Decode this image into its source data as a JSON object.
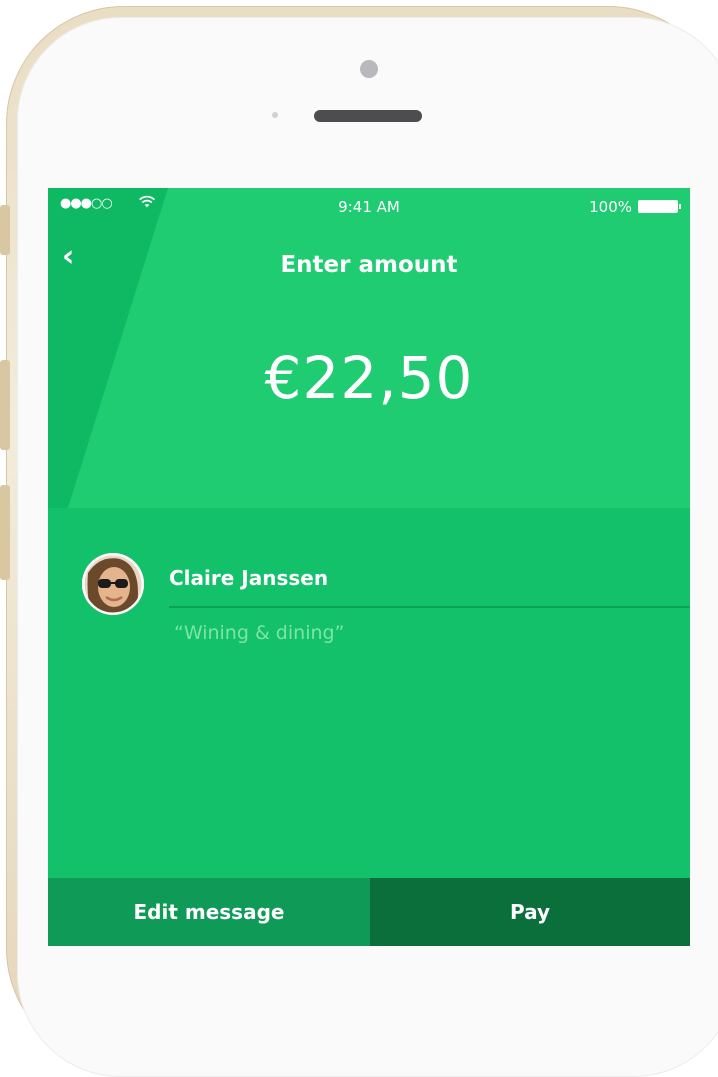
{
  "status_bar": {
    "signal": "●●●○○",
    "time": "9:41 AM",
    "battery": "100%"
  },
  "nav": {
    "back_icon": "‹",
    "title": "Enter amount"
  },
  "amount": "€22,50",
  "recipient": {
    "name": "Claire Janssen",
    "message": "“Wining & dining”"
  },
  "actions": {
    "edit_label": "Edit message",
    "pay_label": "Pay"
  },
  "colors": {
    "accent_green": "#12c16a",
    "pay_button": "#0b6f3b",
    "edit_button": "#0f9b57"
  }
}
